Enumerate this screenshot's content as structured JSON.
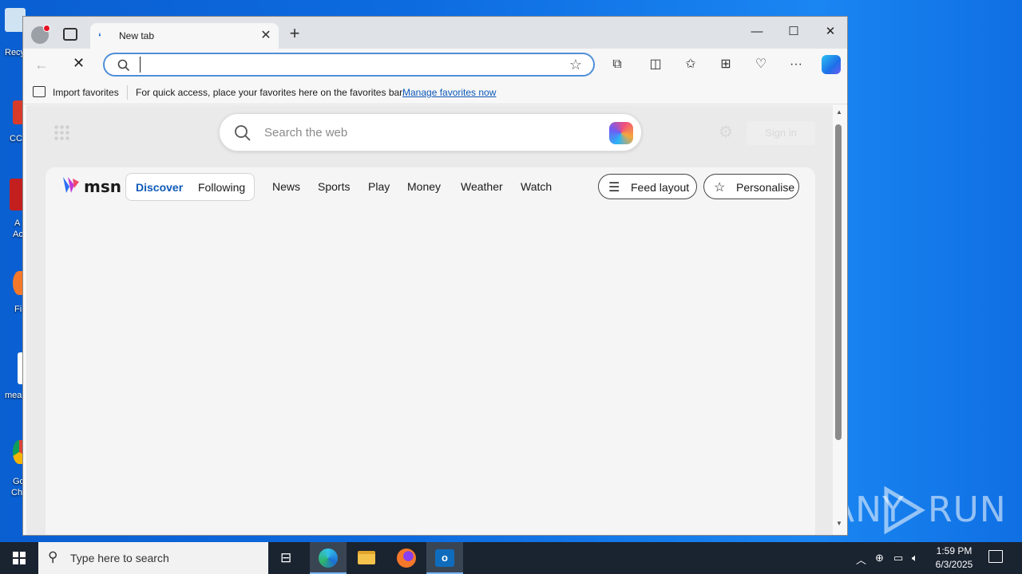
{
  "desktop": {
    "icon_labels": [
      "Recy",
      "CC",
      "A",
      "Ac",
      "Fi",
      "mea",
      "Go",
      "Ch"
    ]
  },
  "watermark": {
    "text_left": "ANY",
    "text_right": "RUN"
  },
  "browser": {
    "tab": {
      "title": "New tab"
    },
    "window_controls": {
      "minimize": "—",
      "maximize": "☐",
      "close": "✕"
    },
    "address_bar": {
      "value": "",
      "placeholder": ""
    },
    "favorites_bar": {
      "import_label": "Import favorites",
      "message": "For quick access, place your favorites here on the favorites bar.",
      "manage_link": "Manage favorites now"
    },
    "newtab": {
      "search_placeholder": "Search the web",
      "signin_label": "Sign in",
      "msn": {
        "logo_text": "msn",
        "pill_tabs": {
          "discover": "Discover",
          "following": "Following"
        },
        "nav": [
          "News",
          "Sports",
          "Play",
          "Money",
          "Weather",
          "Watch"
        ],
        "feed_layout_label": "Feed layout",
        "personalise_label": "Personalise"
      }
    }
  },
  "taskbar": {
    "search_placeholder": "Type here to search",
    "time": "1:59 PM",
    "date": "6/3/2025"
  },
  "colors": {
    "accent": "#0f5ab8",
    "desktop_blue": "#0d6be0",
    "taskbar": "#1a2330"
  }
}
